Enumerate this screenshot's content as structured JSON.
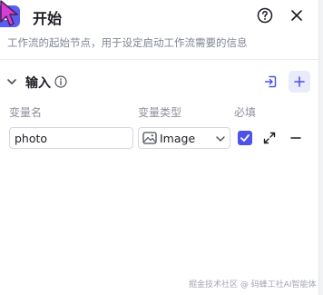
{
  "header": {
    "title": "开始",
    "description": "工作流的起始节点，用于设定启动工作流需要的信息",
    "icons": [
      "start-node-icon",
      "help-icon",
      "close-icon"
    ]
  },
  "input_section": {
    "label": "输入",
    "icons": [
      "chevron-down-icon",
      "info-icon",
      "import-icon",
      "plus-icon"
    ],
    "columns": {
      "name": "变量名",
      "type": "变量类型",
      "required": "必填"
    },
    "rows": [
      {
        "name": "photo",
        "type": "Image",
        "required": true
      }
    ]
  },
  "watermark": "掘金技术社区 @ 码蜂工社AI智能体",
  "colors": {
    "accent": "#4d53e8",
    "node_icon": "#5b5ff0",
    "add_button_bg": "#eaeafd",
    "cursor": "#d63fd6"
  }
}
